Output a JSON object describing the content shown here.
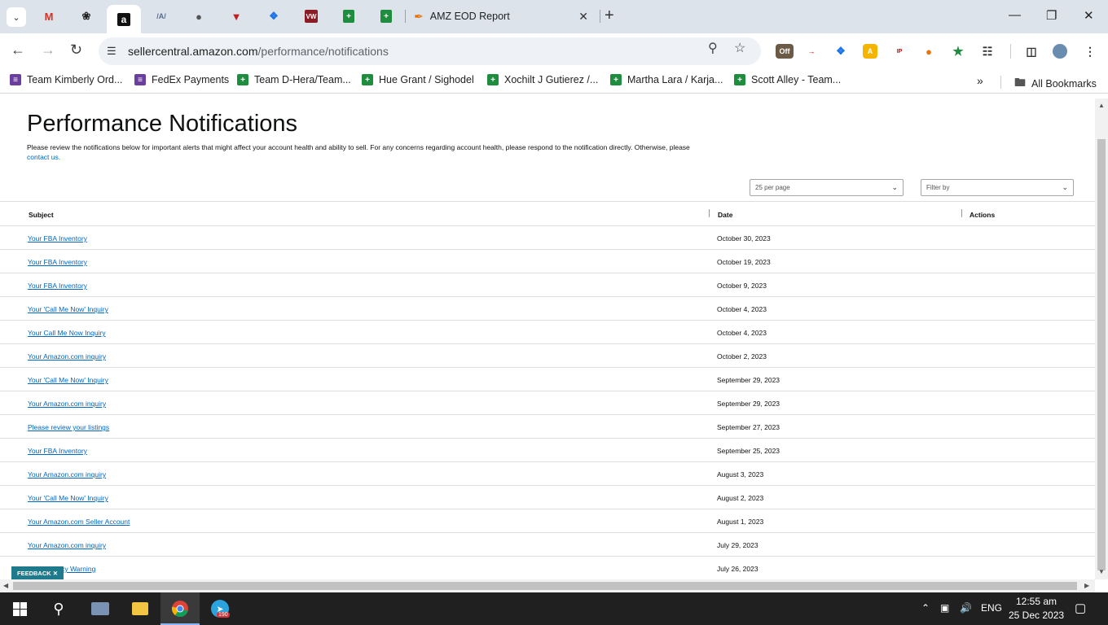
{
  "browser": {
    "active_tab_title": "AMZ EOD Report",
    "url_host": "sellercentral.amazon.com",
    "url_path": "/performance/notifications",
    "bookmarks": [
      {
        "label": "Team Kimberly Ord...",
        "color": "purple"
      },
      {
        "label": "FedEx Payments",
        "color": "purple"
      },
      {
        "label": "Team D-Hera/Team...",
        "color": "green"
      },
      {
        "label": "Hue Grant / Sighodel",
        "color": "green"
      },
      {
        "label": "Xochilt J Gutierez /...",
        "color": "green"
      },
      {
        "label": "Martha Lara / Karja...",
        "color": "green"
      },
      {
        "label": "Scott Alley - Team...",
        "color": "green"
      }
    ],
    "all_bookmarks_label": "All Bookmarks"
  },
  "page": {
    "title": "Performance Notifications",
    "intro": "Please review the notifications below for important alerts that might affect your account health and ability to sell. For any concerns regarding account health, please respond to the notification directly. Otherwise, please",
    "intro_link": "contact us.",
    "per_page": "25 per page",
    "filter_placeholder": "Filter by",
    "columns": {
      "subject": "Subject",
      "date": "Date",
      "actions": "Actions"
    },
    "rows": [
      {
        "subject": "Your FBA Inventory",
        "date": "October 30, 2023"
      },
      {
        "subject": "Your FBA Inventory",
        "date": "October 19, 2023"
      },
      {
        "subject": "Your FBA Inventory",
        "date": "October 9, 2023"
      },
      {
        "subject": "Your 'Call Me Now' Inquiry",
        "date": "October 4, 2023"
      },
      {
        "subject": "Your Call Me Now Inquiry",
        "date": "October 4, 2023"
      },
      {
        "subject": "Your Amazon.com inquiry",
        "date": "October 2, 2023"
      },
      {
        "subject": "Your 'Call Me Now' Inquiry",
        "date": "September 29, 2023"
      },
      {
        "subject": "Your Amazon.com inquiry",
        "date": "September 29, 2023"
      },
      {
        "subject": "Please review your listings",
        "date": "September 27, 2023"
      },
      {
        "subject": "Your FBA Inventory",
        "date": "September 25, 2023"
      },
      {
        "subject": "Your Amazon.com inquiry",
        "date": "August 3, 2023"
      },
      {
        "subject": "Your 'Call Me Now' Inquiry",
        "date": "August 2, 2023"
      },
      {
        "subject": "Your Amazon.com Seller Account",
        "date": "August 1, 2023"
      },
      {
        "subject": "Your Amazon.com inquiry",
        "date": "July 29, 2023"
      },
      {
        "subject": "Listing Policy Warning",
        "date": "July 26, 2023"
      }
    ],
    "feedback_label": "FEEDBACK"
  },
  "taskbar": {
    "telegram_badge": "190",
    "language": "ENG",
    "time": "12:55 am",
    "date": "25 Dec 2023"
  }
}
